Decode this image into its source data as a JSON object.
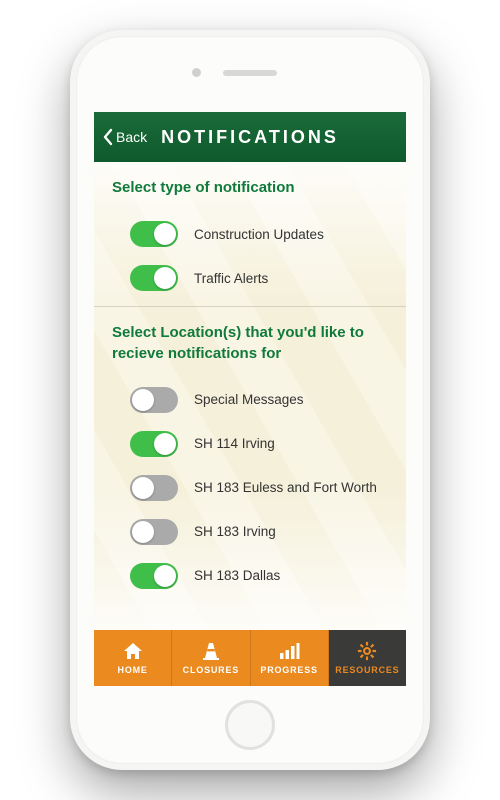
{
  "header": {
    "back_label": "Back",
    "title": "NOTIFICATIONS"
  },
  "sections": {
    "type_title": "Select type of notification",
    "location_title": "Select Location(s) that you'd like to recieve notifications for"
  },
  "type_toggles": [
    {
      "label": "Construction Updates",
      "on": true
    },
    {
      "label": "Traffic Alerts",
      "on": true
    }
  ],
  "location_toggles": [
    {
      "label": "Special Messages",
      "on": false
    },
    {
      "label": "SH 114 Irving",
      "on": true
    },
    {
      "label": "SH 183 Euless and Fort Worth",
      "on": false
    },
    {
      "label": "SH 183 Irving",
      "on": false
    },
    {
      "label": "SH 183 Dallas",
      "on": true
    }
  ],
  "tabs": [
    {
      "label": "HOME",
      "icon": "home-icon",
      "active": false
    },
    {
      "label": "CLOSURES",
      "icon": "cone-icon",
      "active": false
    },
    {
      "label": "PROGRESS",
      "icon": "bars-icon",
      "active": false
    },
    {
      "label": "RESOURCES",
      "icon": "gear-icon",
      "active": true
    }
  ],
  "colors": {
    "accent_green": "#0f7a3a",
    "toggle_on": "#3fbf4a",
    "tab_orange": "#ea8a1f",
    "tab_dark": "#3a3a38"
  }
}
